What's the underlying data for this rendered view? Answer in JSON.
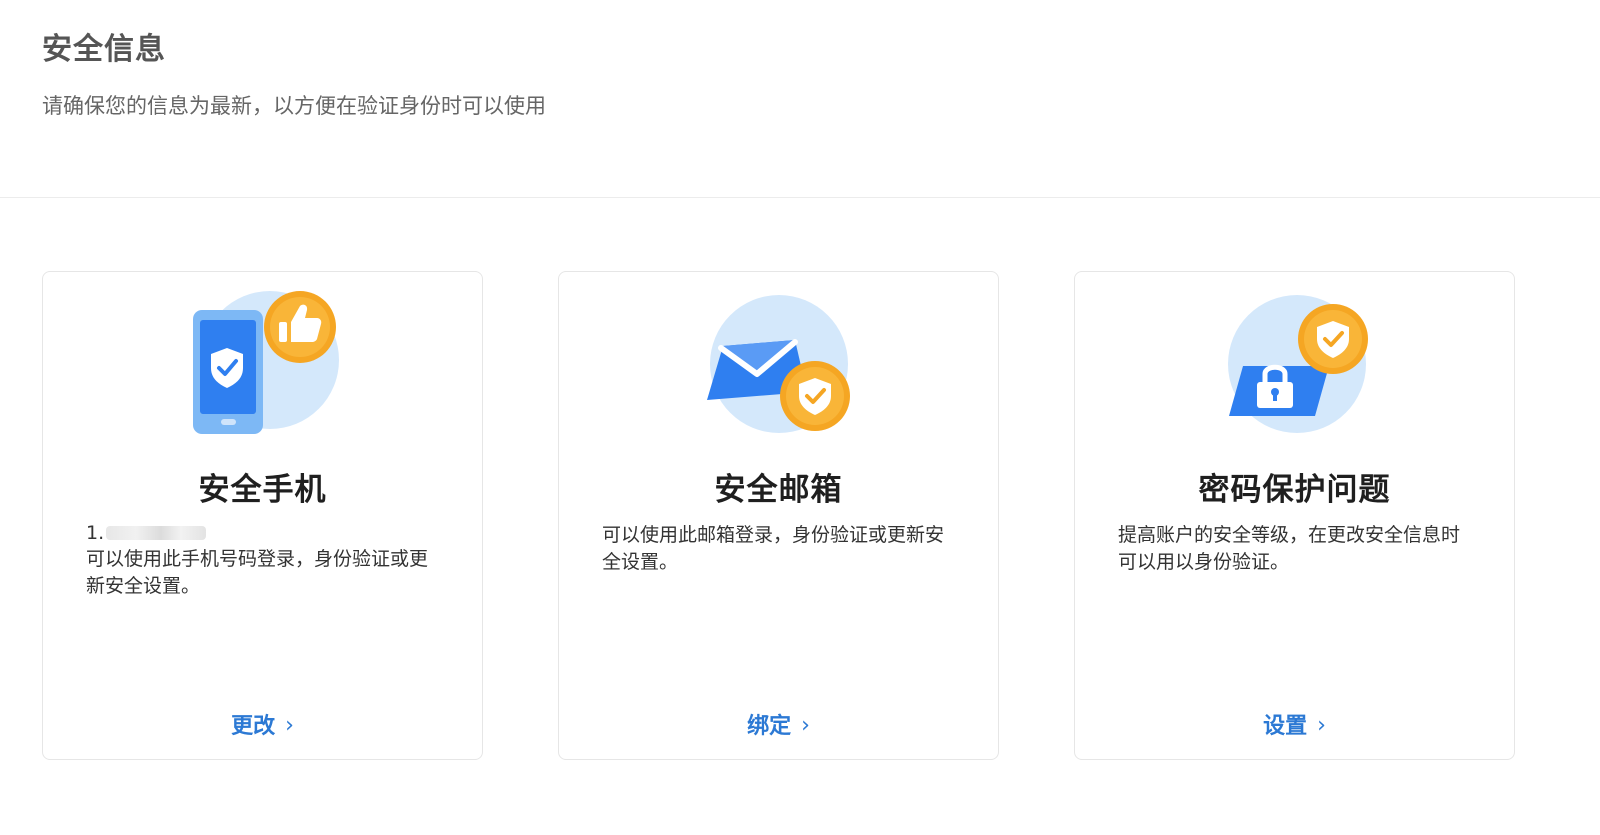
{
  "header": {
    "title": "安全信息",
    "subtitle": "请确保您的信息为最新，以方便在验证身份时可以使用"
  },
  "cards": [
    {
      "title": "安全手机",
      "detail_prefix": "1.",
      "description": "可以使用此手机号码登录，身份验证或更新安全设置。",
      "action_label": "更改",
      "action_icon": "chevron-right-icon",
      "illustration": "phone-shield-thumbs-up-icon"
    },
    {
      "title": "安全邮箱",
      "description": "可以使用此邮箱登录，身份验证或更新安全设置。",
      "action_label": "绑定",
      "action_icon": "chevron-right-icon",
      "illustration": "envelope-shield-icon"
    },
    {
      "title": "密码保护问题",
      "description": "提高账户的安全等级，在更改安全信息时可以用以身份验证。",
      "action_label": "设置",
      "action_icon": "chevron-right-icon",
      "illustration": "lock-shield-icon"
    }
  ],
  "colors": {
    "accent_blue": "#2c79d4",
    "badge_orange": "#f5a623",
    "circle_light_blue": "#d4e8fb",
    "icon_blue": "#3a86f0"
  }
}
